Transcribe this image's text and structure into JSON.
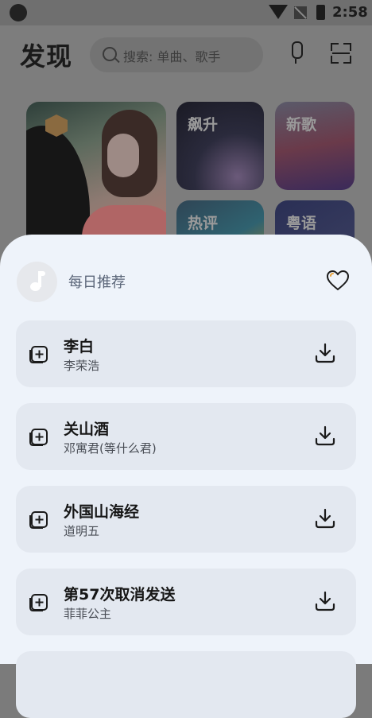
{
  "status_bar": {
    "time": "2:58"
  },
  "header": {
    "title": "发现",
    "search_placeholder": "搜索: 单曲、歌手"
  },
  "categories": [
    {
      "label": "飙升"
    },
    {
      "label": "新歌"
    },
    {
      "label": "热评"
    },
    {
      "label": "粤语"
    }
  ],
  "playlist": {
    "title": "每日推荐"
  },
  "songs": [
    {
      "title": "李白",
      "artist": "李荣浩"
    },
    {
      "title": "关山酒",
      "artist": "邓寓君(等什么君)"
    },
    {
      "title": "外国山海经",
      "artist": "道明五"
    },
    {
      "title": "第57次取消发送",
      "artist": "菲菲公主"
    }
  ],
  "colors": {
    "sheet_bg": "#eef3fa",
    "card_bg": "#e3e8f0",
    "text_primary": "#161616",
    "text_secondary": "#4a4e56"
  },
  "icons": [
    "search-icon",
    "mic-icon",
    "scan-icon",
    "music-note-icon",
    "heart-icon",
    "add-to-playlist-icon",
    "download-icon"
  ]
}
